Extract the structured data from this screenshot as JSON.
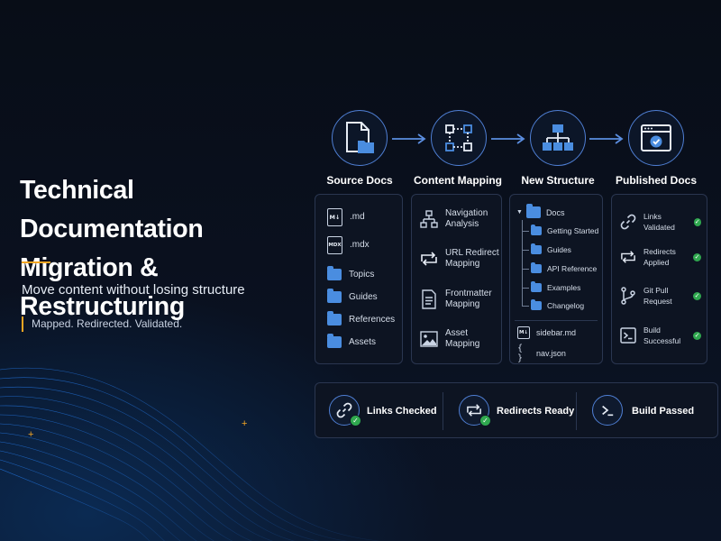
{
  "hero": {
    "title_line1": "Technical Documentation",
    "title_line2": "Migration & Restructuring",
    "subtitle": "Move content without losing structure",
    "tagline": "Mapped. Redirected. Validated."
  },
  "colors": {
    "accent_orange": "#f5a623",
    "accent_blue": "#4f7fd4",
    "folder_blue": "#4a8de0",
    "success_green": "#2fa84f"
  },
  "stages": [
    {
      "label": "Source Docs",
      "icon": "document-folder-icon"
    },
    {
      "label": "Content Mapping",
      "icon": "mapping-nodes-icon"
    },
    {
      "label": "New Structure",
      "icon": "hierarchy-icon"
    },
    {
      "label": "Published Docs",
      "icon": "browser-check-icon"
    }
  ],
  "source_docs": {
    "files": [
      {
        "badge": "M↓",
        "label": ".md"
      },
      {
        "badge": "MDX",
        "label": ".mdx"
      }
    ],
    "folders": [
      "Topics",
      "Guides",
      "References",
      "Assets"
    ]
  },
  "content_mapping": {
    "items": [
      {
        "label_line1": "Navigation",
        "label_line2": "Analysis",
        "icon": "sitemap-icon"
      },
      {
        "label_line1": "URL Redirect",
        "label_line2": "Mapping",
        "icon": "redirect-icon"
      },
      {
        "label_line1": "Frontmatter",
        "label_line2": "Mapping",
        "icon": "document-lines-icon"
      },
      {
        "label_line1": "Asset",
        "label_line2": "Mapping",
        "icon": "image-icon"
      }
    ]
  },
  "new_structure": {
    "root": "Docs",
    "children": [
      "Getting Started",
      "Guides",
      "API Reference",
      "Examples",
      "Changelog"
    ],
    "files": [
      {
        "badge": "M↓",
        "label": "sidebar.md"
      },
      {
        "badge": "{ }",
        "label": "nav.json"
      }
    ]
  },
  "published_docs": {
    "items": [
      {
        "label_line1": "Links Validated",
        "label_line2": "",
        "icon": "link-icon"
      },
      {
        "label_line1": "Redirects",
        "label_line2": "Applied",
        "icon": "redirect-icon"
      },
      {
        "label_line1": "Git Pull",
        "label_line2": "Request",
        "icon": "git-branch-icon"
      },
      {
        "label_line1": "Build",
        "label_line2": "Successful",
        "icon": "terminal-icon"
      }
    ]
  },
  "status": [
    {
      "label": "Links Checked",
      "icon": "link-icon"
    },
    {
      "label": "Redirects Ready",
      "icon": "redirect-icon"
    },
    {
      "label": "Build Passed",
      "icon": "terminal-icon"
    }
  ]
}
